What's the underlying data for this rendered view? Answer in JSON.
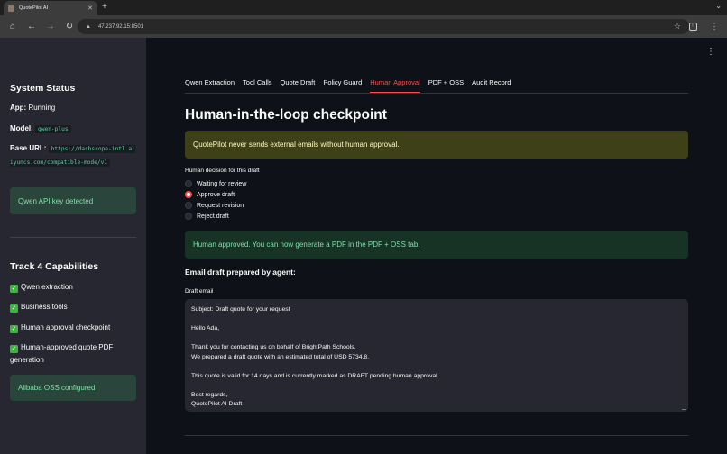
{
  "browser": {
    "tab_title": "QuotePilot AI",
    "url": "47.237.92.15:8501"
  },
  "sidebar": {
    "system_status_title": "System Status",
    "app_label": "App:",
    "app_value": "Running",
    "model_label": "Model:",
    "model_value": "qwen-plus",
    "base_url_label": "Base URL:",
    "base_url_value": "https://dashscope-intl.aliyuncs.com/compatible-mode/v1",
    "api_key_alert": "Qwen API key detected",
    "capabilities_title": "Track 4 Capabilities",
    "capabilities": [
      "Qwen extraction",
      "Business tools",
      "Human approval checkpoint",
      "Human-approved quote PDF generation"
    ],
    "oss_alert": "Alibaba OSS configured"
  },
  "tabs": [
    {
      "label": "Qwen Extraction"
    },
    {
      "label": "Tool Calls"
    },
    {
      "label": "Quote Draft"
    },
    {
      "label": "Policy Guard"
    },
    {
      "label": "Human Approval",
      "active": true
    },
    {
      "label": "PDF + OSS"
    },
    {
      "label": "Audit Record"
    }
  ],
  "main": {
    "title": "Human-in-the-loop checkpoint",
    "info_alert": "QuotePilot never sends external emails without human approval.",
    "decision_label": "Human decision for this draft",
    "options": [
      {
        "label": "Waiting for review",
        "selected": false
      },
      {
        "label": "Approve draft",
        "selected": true
      },
      {
        "label": "Request revision",
        "selected": false
      },
      {
        "label": "Reject draft",
        "selected": false
      }
    ],
    "success_alert": "Human approved. You can now generate a PDF in the PDF + OSS tab.",
    "email_heading": "Email draft prepared by agent:",
    "draft_label": "Draft email",
    "draft_lines": [
      "Subject: Draft quote for your request",
      "",
      "Hello Ada,",
      "",
      "Thank you for contacting us on behalf of BrightPath Schools.",
      "We prepared a draft quote with an estimated total of USD 5734.8.",
      "",
      "This quote is valid for 14 days and is currently marked as DRAFT pending human approval.",
      "",
      "Best regards,",
      "QuotePilot AI Draft"
    ]
  },
  "colors": {
    "accent": "#ff4b4b",
    "success": "#7ee2a8",
    "sidebar_bg": "#262730",
    "main_bg": "#0e1117"
  }
}
